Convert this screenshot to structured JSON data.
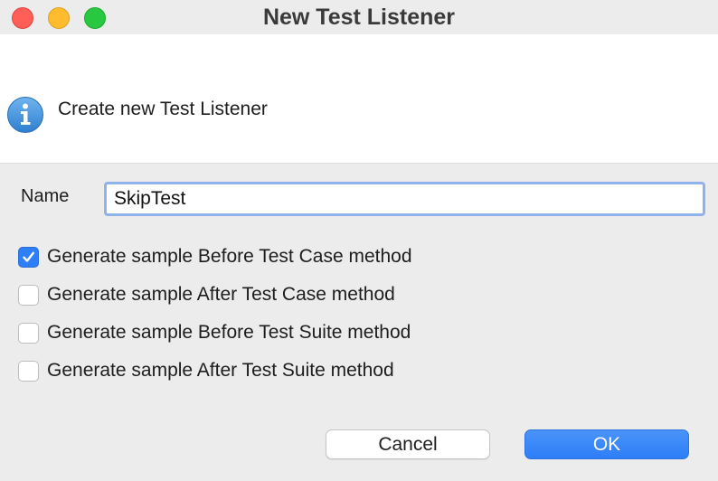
{
  "window": {
    "title": "New Test Listener"
  },
  "banner": {
    "icon": "info-icon",
    "message": "Create new Test Listener"
  },
  "form": {
    "name_label": "Name",
    "name_value": "SkipTest",
    "options": [
      {
        "label": "Generate sample Before Test Case method",
        "checked": true
      },
      {
        "label": "Generate sample After Test Case method",
        "checked": false
      },
      {
        "label": "Generate sample Before Test Suite method",
        "checked": false
      },
      {
        "label": "Generate sample After Test Suite method",
        "checked": false
      }
    ]
  },
  "buttons": {
    "cancel_label": "Cancel",
    "ok_label": "OK"
  },
  "colors": {
    "accent": "#2d7ef7",
    "close": "#ff5f57",
    "minimize": "#febc2e",
    "zoom": "#28c840",
    "info_icon": "#3b8fd9"
  }
}
